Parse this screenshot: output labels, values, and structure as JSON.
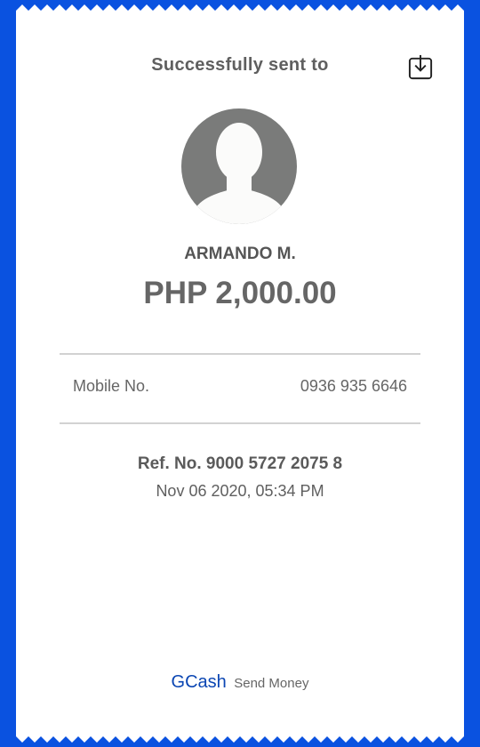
{
  "colors": {
    "background": "#0a52e0",
    "brand": "#0b46b3",
    "avatar": "#7a7b7a"
  },
  "receipt": {
    "title": "Successfully sent to",
    "download_icon": "download-icon",
    "recipient": {
      "avatar_icon": "avatar-placeholder",
      "name": "ARMANDO M."
    },
    "amount": "PHP 2,000.00",
    "details": {
      "mobile_label": "Mobile No.",
      "mobile_value": "0936 935 6646"
    },
    "reference": "Ref. No. 9000 5727 2075 8",
    "timestamp": "Nov 06 2020, 05:34 PM",
    "footer": {
      "brand": "GCash",
      "service": "Send Money"
    }
  }
}
